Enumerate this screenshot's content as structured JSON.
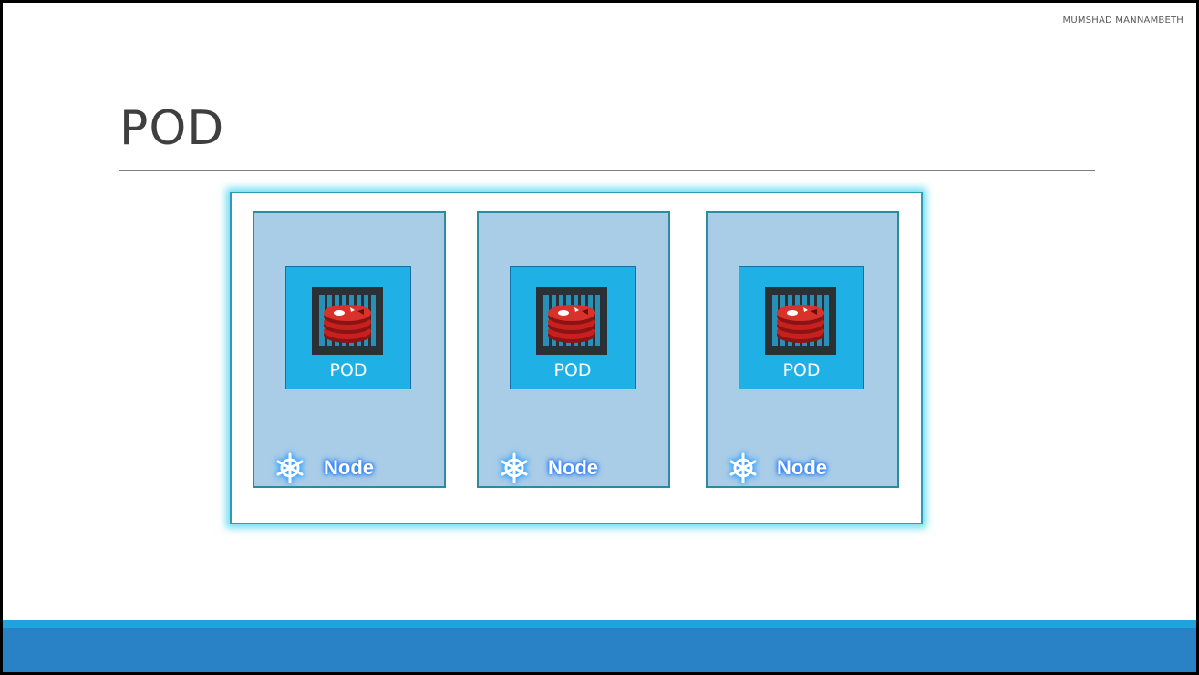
{
  "author": "MUMSHAD MANNAMBETH",
  "title": "POD",
  "nodes": [
    {
      "label": "Node",
      "pod_label": "POD",
      "icon": "kubernetes-helm-icon",
      "app_icon": "redis-icon"
    },
    {
      "label": "Node",
      "pod_label": "POD",
      "icon": "kubernetes-helm-icon",
      "app_icon": "redis-icon"
    },
    {
      "label": "Node",
      "pod_label": "POD",
      "icon": "kubernetes-helm-icon",
      "app_icon": "redis-icon"
    }
  ],
  "colors": {
    "cluster_border": "#2b9db6",
    "cluster_glow": "#55d7f0",
    "node_fill": "#a9cde7",
    "pod_fill": "#1fb1e6",
    "container_fill": "#2b3035",
    "redis_red": "#c8201e",
    "footer_accent": "#1fa3dc",
    "footer_bar": "#2982c6"
  }
}
